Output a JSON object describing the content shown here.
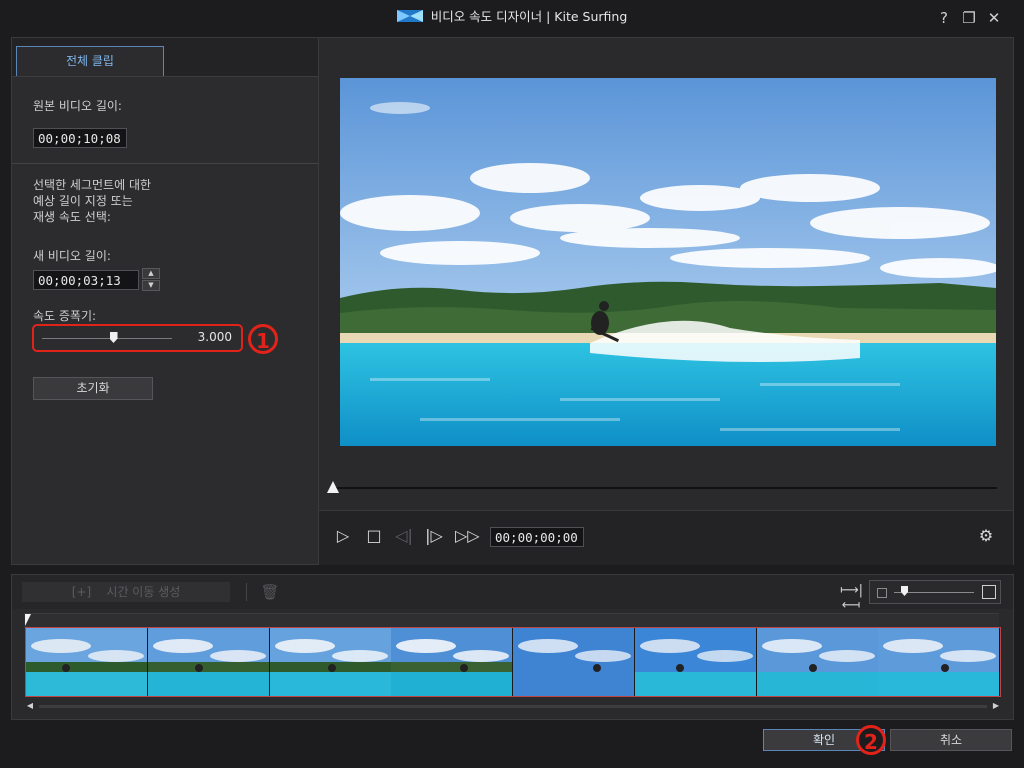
{
  "window": {
    "title": "비디오 속도 디자이너  |  Kite Surfing",
    "help_label": "?",
    "restore_label": "❐",
    "close_label": "✕"
  },
  "left_panel": {
    "tab_label": "전체 클립",
    "original_length_label": "원본 비디오 길이:",
    "original_length_value": "00;00;10;08",
    "instruction_lines": [
      "선택한 세그먼트에 대한",
      "예상 길이 지정 또는",
      "재생 속도 선택:"
    ],
    "new_length_label": "새 비디오 길이:",
    "new_length_value": "00;00;03;13",
    "speed_label": "속도 증폭기:",
    "speed_value": "3.000",
    "speed_slider_fraction": 0.55,
    "reset_label": "초기화",
    "badge_1": "1"
  },
  "preview": {
    "current_time": "00;00;00;00",
    "seek_fraction": 0.0
  },
  "storyboard": {
    "create_shift_label": "시간 이동 생성",
    "thumbnail_count": 8
  },
  "footer": {
    "ok_label": "확인",
    "cancel_label": "취소",
    "badge_2": "2"
  },
  "colors": {
    "accent": "#5a87b8",
    "highlight_red": "#e2231a",
    "background": "#1c1c1e",
    "panel": "#2c2c2e"
  }
}
